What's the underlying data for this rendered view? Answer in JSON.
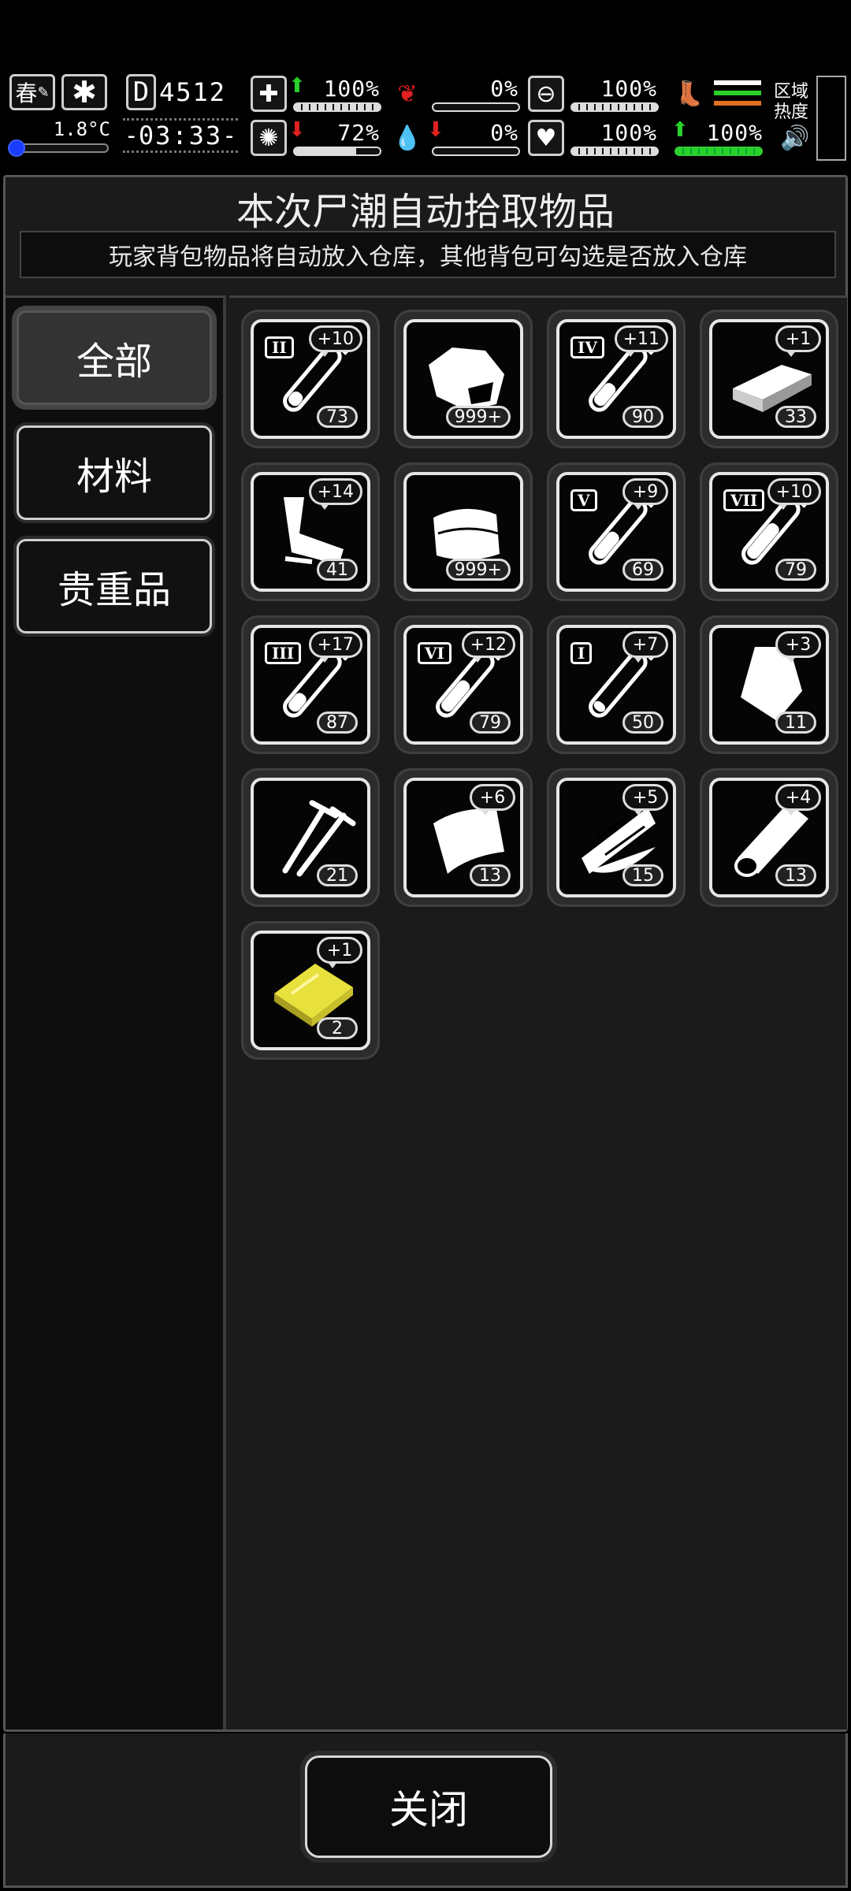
{
  "status_bar": {
    "season": "春",
    "temperature": "1.8°C",
    "day_counter": "4512",
    "day_prefix": "D",
    "clock": "03:33",
    "region_heat_label": "区域热度",
    "stats": [
      {
        "name": "health",
        "value": "100%",
        "trend": "up",
        "level": 1.0
      },
      {
        "name": "stomach",
        "value": "0%",
        "trend": "",
        "level": 0.0
      },
      {
        "name": "pill",
        "value": "100%",
        "trend": "",
        "level": 1.0
      },
      {
        "name": "sanity",
        "value": "72%",
        "trend": "down",
        "level": 0.72
      },
      {
        "name": "blood",
        "value": "0%",
        "trend": "down",
        "level": 0.0
      },
      {
        "name": "heart",
        "value": "100%",
        "trend": "",
        "level": 1.0
      },
      {
        "name": "stamina",
        "value": "100%",
        "trend": "up",
        "level": 1.0
      }
    ]
  },
  "dialog": {
    "title": "本次尸潮自动拾取物品",
    "subtitle": "玩家背包物品将自动放入仓库，其他背包可勾选是否放入仓库",
    "tabs": [
      {
        "label": "全部",
        "active": true
      },
      {
        "label": "材料",
        "active": false
      },
      {
        "label": "贵重品",
        "active": false
      }
    ],
    "items": [
      {
        "icon": "tube-icon",
        "roman": "II",
        "fill": 0.25,
        "bonus": "+10",
        "qty": "73"
      },
      {
        "icon": "meat-icon",
        "roman": "",
        "bonus": "",
        "qty": "999+"
      },
      {
        "icon": "tube-icon",
        "roman": "IV",
        "fill": 0.45,
        "bonus": "+11",
        "qty": "90"
      },
      {
        "icon": "bar-icon",
        "roman": "",
        "bonus": "+1",
        "qty": "33"
      },
      {
        "icon": "scrap-icon",
        "roman": "",
        "bonus": "+14",
        "qty": "41"
      },
      {
        "icon": "cloth-icon",
        "roman": "",
        "bonus": "",
        "qty": "999+"
      },
      {
        "icon": "tube-icon",
        "roman": "V",
        "fill": 0.55,
        "bonus": "+9",
        "qty": "69"
      },
      {
        "icon": "tube-icon",
        "roman": "VII",
        "fill": 0.75,
        "bonus": "+10",
        "qty": "79"
      },
      {
        "icon": "tube-icon",
        "roman": "III",
        "fill": 0.35,
        "bonus": "+17",
        "qty": "87"
      },
      {
        "icon": "tube-icon",
        "roman": "VI",
        "fill": 0.65,
        "bonus": "+12",
        "qty": "79"
      },
      {
        "icon": "tube-icon",
        "roman": "I",
        "fill": 0.15,
        "bonus": "+7",
        "qty": "50"
      },
      {
        "icon": "bag-icon",
        "roman": "",
        "bonus": "+3",
        "qty": "11"
      },
      {
        "icon": "nails-icon",
        "roman": "",
        "bonus": "",
        "qty": "21"
      },
      {
        "icon": "leather-icon",
        "roman": "",
        "bonus": "+6",
        "qty": "13"
      },
      {
        "icon": "wood-icon",
        "roman": "",
        "bonus": "+5",
        "qty": "15"
      },
      {
        "icon": "log-icon",
        "roman": "",
        "bonus": "+4",
        "qty": "13"
      },
      {
        "icon": "gold-plate-icon",
        "roman": "",
        "bonus": "+1",
        "qty": "2"
      }
    ],
    "close_label": "关闭"
  },
  "colors": {
    "accent_green": "#2bd12b",
    "alert_red": "#e02020",
    "gold": "#e8e03c"
  }
}
